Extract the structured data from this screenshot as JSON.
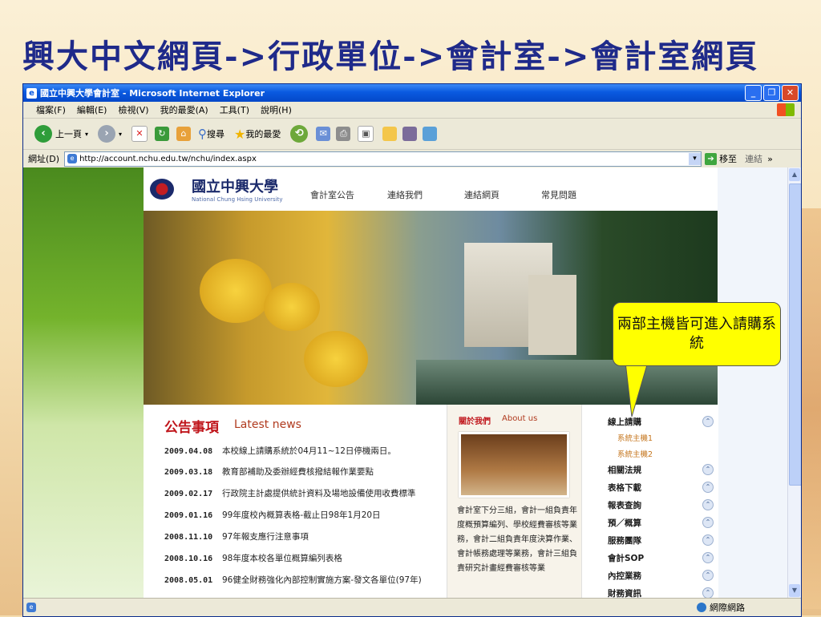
{
  "slide": {
    "title": "興大中文網頁->行政單位->會計室->會計室網頁"
  },
  "window": {
    "title": "國立中興大學會計室 - Microsoft Internet Explorer",
    "buttons": {
      "min": "_",
      "max": "❐",
      "close": "✕"
    }
  },
  "menu": [
    "檔案(F)",
    "編輯(E)",
    "檢視(V)",
    "我的最愛(A)",
    "工具(T)",
    "說明(H)"
  ],
  "toolbar": {
    "back": "上一頁",
    "search": "搜尋",
    "favorites": "我的最愛"
  },
  "address": {
    "label": "網址(D)",
    "url": "http://account.nchu.edu.tw/nchu/index.aspx",
    "go": "移至",
    "links": "連結"
  },
  "status": {
    "zone": "網際網路"
  },
  "site": {
    "logo": "國立中興大學",
    "logo_sub": "National Chung Hsing University",
    "nav": [
      "會計室公告",
      "連絡我們",
      "連結網頁",
      "常見問題"
    ],
    "news": {
      "title": "公告事項",
      "subtitle": "Latest news",
      "items": [
        {
          "date": "2009.04.08",
          "text": "本校線上請購系統於04月11~12日停機兩日。"
        },
        {
          "date": "2009.03.18",
          "text": "教育部補助及委辦經費核撥結報作業要點"
        },
        {
          "date": "2009.02.17",
          "text": "行政院主計處提供統計資料及場地設備使用收費標準"
        },
        {
          "date": "2009.01.16",
          "text": "99年度校內概算表格-截止日98年1月20日"
        },
        {
          "date": "2008.11.10",
          "text": "97年報支應行注意事項"
        },
        {
          "date": "2008.10.16",
          "text": "98年度本校各單位概算編列表格"
        },
        {
          "date": "2008.05.01",
          "text": "96健全財務強化內部控制實施方案-發文各單位(97年)"
        }
      ]
    },
    "about": {
      "title": "關於我們",
      "subtitle": "About us",
      "text": "會計室下分三組，會計一組負責年度概預算編列、學校經費審核等業務，會計二組負責年度決算作業、會計帳務處理等業務，會計三組負責研究計畫經費審核等業"
    },
    "side": {
      "items": [
        "線上請購",
        "相關法規",
        "表格下載",
        "報表查詢",
        "預／概算",
        "服務團隊",
        "會計SOP",
        "內控業務",
        "財務資訊"
      ],
      "subitems": [
        "系統主機1",
        "系統主機2"
      ],
      "toggle": "⌃"
    }
  },
  "callout": "兩部主機皆可進入請購系統"
}
